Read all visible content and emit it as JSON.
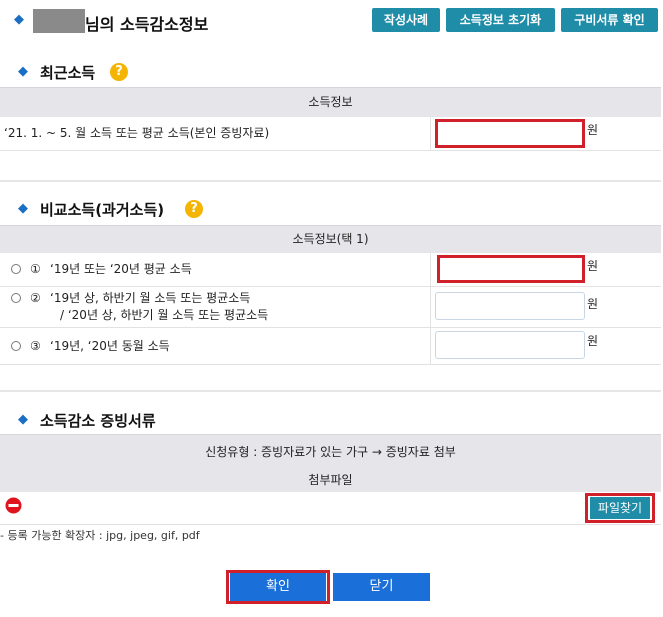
{
  "header": {
    "title_suffix": "님의 소득감소정보",
    "buttons": {
      "examples": "작성사례",
      "reset": "소득정보 초기화",
      "docs_check": "구비서류 확인"
    }
  },
  "recent": {
    "title": "최근소득",
    "help_glyph": "?",
    "table_header": "소득정보",
    "row_label": "‘21. 1. ~ 5. 월 소득 또는 평균 소득(본인 증빙자료)",
    "input_value": "",
    "unit": "원"
  },
  "compare": {
    "title": "비교소득(과거소득)",
    "help_glyph": "?",
    "table_header": "소득정보(택 1)",
    "options": [
      {
        "num": "①",
        "label": "‘19년 또는 ‘20년 평균 소득",
        "label2": "",
        "value": "",
        "unit": "원"
      },
      {
        "num": "②",
        "label": "‘19년 상, 하반기 월 소득 또는 평균소득",
        "label2": "/ ‘20년 상, 하반기 월 소득 또는 평균소득",
        "value": "",
        "unit": "원"
      },
      {
        "num": "③",
        "label": "‘19년, ‘20년 동월 소득",
        "label2": "",
        "value": "",
        "unit": "원"
      }
    ]
  },
  "proof": {
    "title": "소득감소 증빙서류",
    "apply_type": "신청유형 : 증빙자료가 있는 가구 → 증빙자료 첨부",
    "attach_header": "첨부파일",
    "find_file": "파일찾기",
    "allowed_ext": "- 등록 가능한 확장자 : jpg, jpeg, gif, pdf"
  },
  "footer": {
    "confirm": "확인",
    "close": "닫기"
  },
  "colors": {
    "accent": "#1a6fc4",
    "teal_button": "#1f8ca8",
    "primary_button": "#1a6fd8",
    "highlight": "#d0202a",
    "help": "#f5b400",
    "table_header_bg": "#e5e5ea"
  },
  "icons": {
    "section_marker": "diamond-icon",
    "help": "question-circle-icon",
    "remove": "minus-circle-icon"
  }
}
